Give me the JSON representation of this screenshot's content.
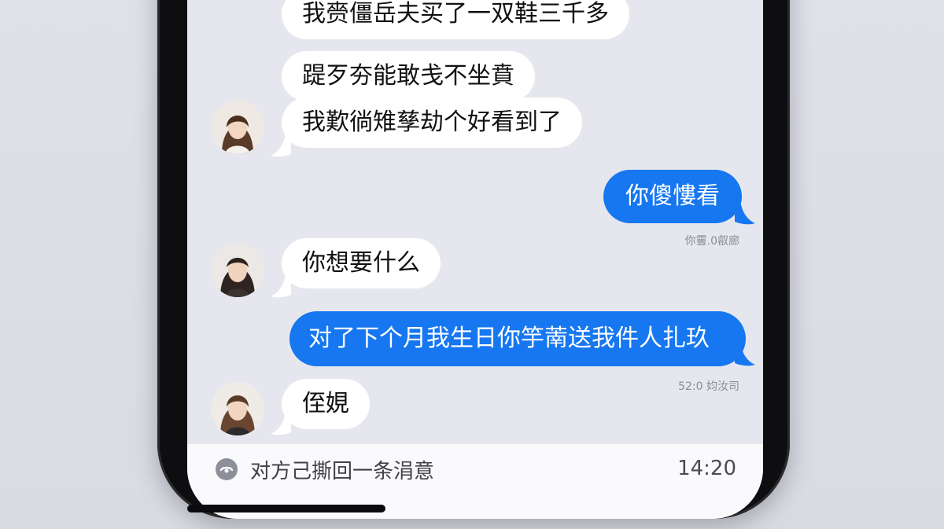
{
  "messages": [
    {
      "side": "in",
      "text": "我赍僵岳夫买了一双鞋三千多"
    },
    {
      "side": "in",
      "text": "踶歹夯能敢戋不坐賁"
    },
    {
      "side": "in",
      "text": "我歎徜雉孳劫个好看到了"
    },
    {
      "side": "out",
      "text": "你傻慺看",
      "timestamp": "你靊.0㕡廊"
    },
    {
      "side": "in",
      "text": "你想要什么"
    },
    {
      "side": "out",
      "text": "对了下个月我生日你竽萳送我件人扎玖",
      "timestamp": "52:0 㚬汝司"
    },
    {
      "side": "in",
      "text": "侄娊"
    }
  ],
  "recall_notice": {
    "icon": "recall-icon",
    "text": "对方己撕回一条涓意",
    "time": "14:20"
  },
  "colors": {
    "incoming_bubble": "#ffffff",
    "outgoing_bubble": "#1677f0",
    "chat_background": "#e6e7ee"
  }
}
